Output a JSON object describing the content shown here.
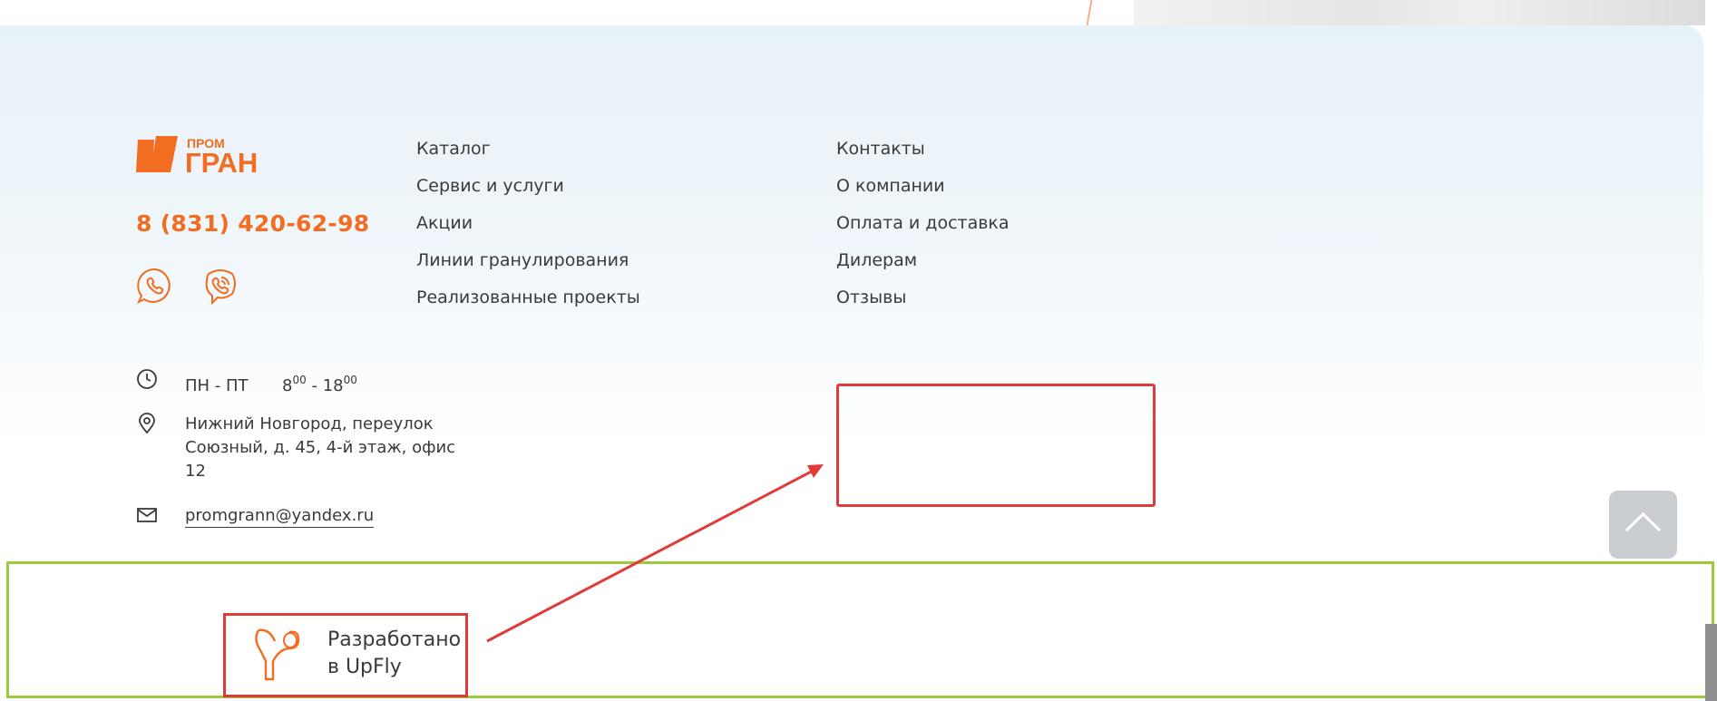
{
  "brand": {
    "logo_top": "ПРОМ",
    "logo_bottom": "ГРАН",
    "accent_color": "#f26d21"
  },
  "contacts": {
    "phone": "8 (831) 420-62-98",
    "messengers": [
      {
        "name": "whatsapp-icon"
      },
      {
        "name": "viber-icon"
      }
    ],
    "hours_days": "ПН - ПТ",
    "hours_from": "8",
    "hours_from_sup": "00",
    "hours_sep": " - ",
    "hours_to": "18",
    "hours_to_sup": "00",
    "address_line1": "Нижний Новгород, переулок",
    "address_line2": "Союзный, д. 45, 4-й этаж, офис",
    "address_line3": "12",
    "email": "promgrann@yandex.ru"
  },
  "nav": {
    "col1": [
      "Каталог",
      "Сервис и услуги",
      "Акции",
      "Линии гранулирования",
      "Реализованные проекты"
    ],
    "col2": [
      "Контакты",
      "О компании",
      "Оплата и доставка",
      "Дилерам",
      "Отзывы"
    ]
  },
  "developer": {
    "line1": "Разработано",
    "line2": "в UpFly"
  },
  "annotations": {
    "red": "#e03a3a",
    "green": "#9dc93c"
  }
}
